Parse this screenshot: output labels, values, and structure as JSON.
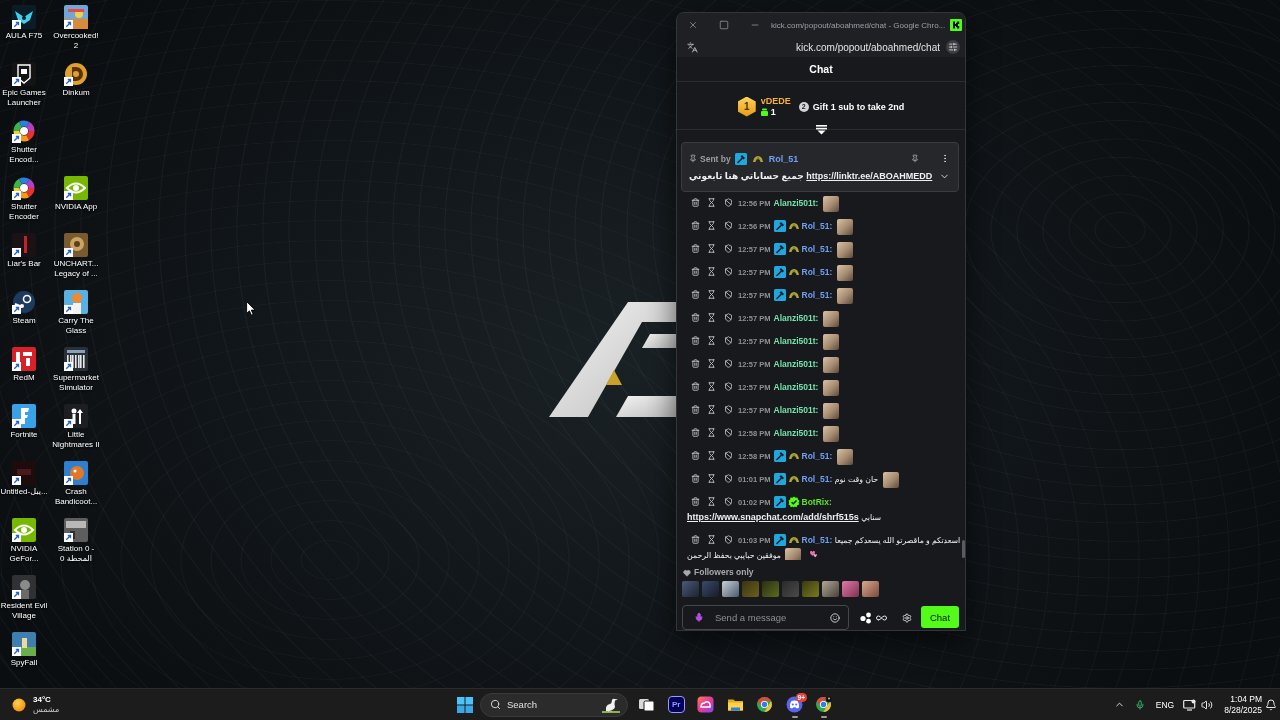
{
  "desktop": {
    "icon_rows": [
      {
        "icons": [
          {
            "kind": "aula",
            "label": "AULA F75"
          },
          {
            "kind": "overcooked",
            "label": "Overcooked! 2"
          }
        ]
      },
      {
        "icons": [
          {
            "kind": "epic",
            "label": "Epic Games Launcher"
          },
          {
            "kind": "dinkum",
            "label": "Dinkum"
          }
        ]
      },
      {
        "icons": [
          {
            "kind": "shutter",
            "label": "Shutter Encod..."
          }
        ]
      },
      {
        "icons": [
          {
            "kind": "shutter",
            "label": "Shutter Encoder"
          },
          {
            "kind": "nvidia",
            "label": "NVIDIA App"
          }
        ]
      },
      {
        "icons": [
          {
            "kind": "liars",
            "label": "Liar's Bar"
          },
          {
            "kind": "uncharted",
            "label": "UNCHART... Legacy of ..."
          }
        ]
      },
      {
        "icons": [
          {
            "kind": "steam",
            "label": "Steam"
          },
          {
            "kind": "carry",
            "label": "Carry The Glass"
          }
        ]
      },
      {
        "icons": [
          {
            "kind": "redm",
            "label": "RedM"
          },
          {
            "kind": "supermarket",
            "label": "Supermarket Simulator"
          }
        ]
      },
      {
        "icons": [
          {
            "kind": "fortnite",
            "label": "Fortnite"
          },
          {
            "kind": "nightmares",
            "label": "Little Nightmares II"
          }
        ]
      },
      {
        "icons": [
          {
            "kind": "untitled",
            "label": "Untitled-يبل..."
          },
          {
            "kind": "crash",
            "label": "Crash Bandicoot..."
          }
        ]
      },
      {
        "icons": [
          {
            "kind": "nvidia",
            "label": "NVIDIA GeFor..."
          },
          {
            "kind": "station",
            "label": "Station 0 - المحطة 0"
          }
        ]
      },
      {
        "icons": [
          {
            "kind": "resident",
            "label": "Resident Evil Village"
          }
        ]
      },
      {
        "icons": [
          {
            "kind": "spyfall",
            "label": "SpyFall"
          }
        ]
      }
    ]
  },
  "chat_window": {
    "window_title": "kick.com/popout/aboahmed/chat - Google Chro...",
    "address": "kick.com/popout/aboahmed/chat",
    "title": "Chat",
    "leaderboard": {
      "leader": {
        "rank": "1",
        "name": "vDEDE",
        "gifts": "1"
      },
      "next": {
        "rank": "2",
        "text": "Gift 1 sub to take 2nd"
      }
    },
    "pinned": {
      "label": "Sent by",
      "badges": [
        {
          "kind": "moderator"
        },
        {
          "kind": "og"
        }
      ],
      "user": "Rol_51",
      "color": "#6f9ff2",
      "parts": [
        {
          "kind": "text",
          "text": "جميع حساباتي هنا تابعوني"
        },
        {
          "kind": "link",
          "text": "https://linktr.ee/ABOAHMEDD"
        }
      ],
      "expanded": false
    },
    "messages": [
      {
        "time": "12:56 PM",
        "user": "Alanzi501t:",
        "color": "#74e3ae",
        "parts": [
          {
            "kind": "emote"
          }
        ]
      },
      {
        "time": "12:56 PM",
        "badges": [
          {
            "kind": "moderator"
          },
          {
            "kind": "og"
          }
        ],
        "user": "Rol_51:",
        "color": "#6f9ff2",
        "parts": [
          {
            "kind": "emote"
          }
        ]
      },
      {
        "time": "12:57 PM",
        "badges": [
          {
            "kind": "moderator"
          },
          {
            "kind": "og"
          }
        ],
        "user": "Rol_51:",
        "color": "#6f9ff2",
        "parts": [
          {
            "kind": "emote"
          }
        ]
      },
      {
        "time": "12:57 PM",
        "badges": [
          {
            "kind": "moderator"
          },
          {
            "kind": "og"
          }
        ],
        "user": "Rol_51:",
        "color": "#6f9ff2",
        "parts": [
          {
            "kind": "emote"
          }
        ]
      },
      {
        "time": "12:57 PM",
        "badges": [
          {
            "kind": "moderator"
          },
          {
            "kind": "og"
          }
        ],
        "user": "Rol_51:",
        "color": "#6f9ff2",
        "parts": [
          {
            "kind": "emote"
          }
        ]
      },
      {
        "time": "12:57 PM",
        "user": "Alanzi501t:",
        "color": "#74e3ae",
        "parts": [
          {
            "kind": "emote"
          }
        ]
      },
      {
        "time": "12:57 PM",
        "user": "Alanzi501t:",
        "color": "#74e3ae",
        "parts": [
          {
            "kind": "emote"
          }
        ]
      },
      {
        "time": "12:57 PM",
        "user": "Alanzi501t:",
        "color": "#74e3ae",
        "parts": [
          {
            "kind": "emote"
          }
        ]
      },
      {
        "time": "12:57 PM",
        "user": "Alanzi501t:",
        "color": "#74e3ae",
        "parts": [
          {
            "kind": "emote"
          }
        ]
      },
      {
        "time": "12:57 PM",
        "user": "Alanzi501t:",
        "color": "#74e3ae",
        "parts": [
          {
            "kind": "emote"
          }
        ]
      },
      {
        "time": "12:58 PM",
        "user": "Alanzi501t:",
        "color": "#74e3ae",
        "parts": [
          {
            "kind": "emote"
          }
        ]
      },
      {
        "time": "12:58 PM",
        "badges": [
          {
            "kind": "moderator"
          },
          {
            "kind": "og"
          }
        ],
        "user": "Rol_51:",
        "color": "#6f9ff2",
        "parts": [
          {
            "kind": "emote"
          }
        ]
      },
      {
        "time": "01:01 PM",
        "badges": [
          {
            "kind": "moderator"
          },
          {
            "kind": "og"
          }
        ],
        "user": "Rol_51:",
        "color": "#6f9ff2",
        "parts": [
          {
            "kind": "text",
            "text": "حان وقت نوم"
          },
          {
            "kind": "emote"
          }
        ]
      },
      {
        "time": "01:02 PM",
        "badges": [
          {
            "kind": "moderator"
          },
          {
            "kind": "verified"
          }
        ],
        "user": "BotRix:",
        "color": "#5ce128",
        "parts": [
          {
            "kind": "link",
            "text": "https://www.snapchat.com/add/shrf515s"
          },
          {
            "kind": "text",
            "text": "سنابي"
          }
        ]
      },
      {
        "time": "01:03 PM",
        "badges": [
          {
            "kind": "moderator"
          },
          {
            "kind": "og"
          }
        ],
        "user": "Rol_51:",
        "color": "#6f9ff2",
        "parts": [
          {
            "kind": "text",
            "text": "اسعدتكم و ماقصرتو الله يسعدكم جميعا"
          },
          {
            "kind": "text",
            "text": "موفقين حبايبي بحفظ الرحمن"
          },
          {
            "kind": "emote"
          },
          {
            "kind": "hearts"
          }
        ]
      }
    ],
    "mode": "Followers only",
    "input": {
      "placeholder": "Send a message"
    },
    "send_button": "Chat"
  },
  "taskbar": {
    "weather": {
      "temperature": "34°C",
      "condition": "مشمس"
    },
    "search_label": "Search",
    "apps": [
      {
        "kind": "task-view",
        "running": false
      },
      {
        "kind": "premiere",
        "text": "Pr",
        "running": false
      },
      {
        "kind": "creative-cloud",
        "running": false
      },
      {
        "kind": "explorer",
        "running": false
      },
      {
        "kind": "chrome",
        "running": false
      },
      {
        "kind": "discord",
        "badge": "9+",
        "running": true
      },
      {
        "kind": "chrome-profile",
        "running": true
      }
    ],
    "language": "ENG",
    "time": "1:04 PM",
    "date": "8/28/2025"
  }
}
